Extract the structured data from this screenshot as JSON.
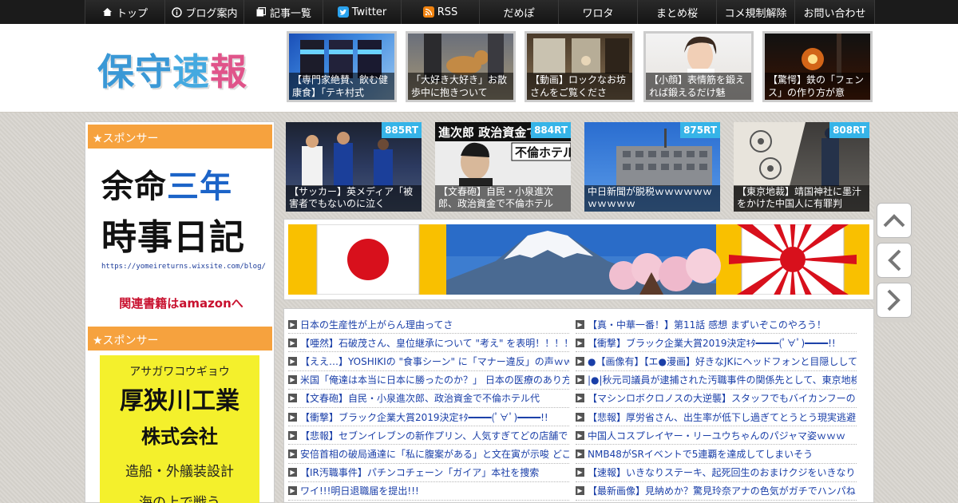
{
  "nav": {
    "items": [
      {
        "label": "トップ",
        "icon": "home-icon"
      },
      {
        "label": "ブログ案内",
        "icon": "info-icon"
      },
      {
        "label": "記事一覧",
        "icon": "list-icon"
      },
      {
        "label": "Twitter",
        "icon": "twitter-icon"
      },
      {
        "label": "RSS",
        "icon": "rss-icon"
      },
      {
        "label": "だめぽ",
        "icon": ""
      },
      {
        "label": "ワロタ",
        "icon": ""
      },
      {
        "label": "まとめ桜",
        "icon": ""
      },
      {
        "label": "コメ規制解除",
        "icon": ""
      },
      {
        "label": "お問い合わせ",
        "icon": ""
      }
    ]
  },
  "header": {
    "logo": [
      "保",
      "守",
      "速",
      "報"
    ],
    "thumbs": [
      {
        "caption": "【専門家絶賛、飲む健康食】「テキ村式"
      },
      {
        "caption": "「大好き大好き」お散歩中に抱きついて"
      },
      {
        "caption": "【動画】ロックなお坊さんをご覧くださ"
      },
      {
        "caption": "【小顔】表情筋を鍛えれば鍛えるだけ魅"
      },
      {
        "caption": "【驚愕】鉄の「フェンス」の作り方が意"
      }
    ]
  },
  "sidebar": {
    "sponsor1": "★スポンサー",
    "ad1": {
      "line1a": "余命",
      "line1b": "三年",
      "line2": "時事日記",
      "url": "https://yomeireturns.wixsite.com/blog/",
      "amazon": "関連書籍はamazonへ"
    },
    "sponsor2": "★スポンサー",
    "ad2": {
      "kana": "アサガワコウギョウ",
      "name": "厚狭川工業",
      "corp": "株式会社",
      "service": "造船・外艤装設計",
      "more": "海の上で戦う"
    }
  },
  "main": {
    "rt_items": [
      {
        "badge": "885RT",
        "caption": "【サッカー】英メディア「被害者でもないのに泣く"
      },
      {
        "badge": "884RT",
        "caption": "【文春砲】自民・小泉進次郎、政治資金で不倫ホテル"
      },
      {
        "badge": "875RT",
        "caption": "中日新聞が脱税ｗｗｗｗｗｗｗｗｗｗｗ"
      },
      {
        "badge": "808RT",
        "caption": "【東京地裁】靖国神社に墨汁をかけた中国人に有罪判"
      }
    ],
    "list_left": [
      "日本の生産性が上がらん理由ってさ",
      "【唖然】石破茂さん、皇位継承について \"考え\" を表明！！！！",
      "【ええ…】YOSHIKIの \"食事シーン\" に「マナー違反」の声ｗｗｗ",
      "米国「俺達は本当に日本に勝ったのか？」 日本の医療のあり方",
      "【文春砲】自民・小泉進次郎、政治資金で不倫ホテル代",
      "【衝撃】ブラック企業大賞2019決定ｷﾀ━━━━(ﾟ∀ﾟ)━━━━!!",
      "【悲報】セブンイレブンの新作プリン、人気すぎてどの店舗で",
      "安倍首相の破局通達に「私に腹案がある」と文在寅が示唆 どこ",
      "【IR汚職事件】パチンコチェーン「ガイア」本社を捜索",
      "ワイ!!!明日退職届を提出!!!"
    ],
    "list_right": [
      "【真・中華一番！】第11話 感想 まずいぞこのやろう！",
      "【衝撃】ブラック企業大賞2019決定ｷﾀ━━━━(ﾟ∀ﾟ)━━━━!!",
      "●【画像有】【エ●漫画】好きなJKにヘッドフォンと目隠しして",
      "|●|秋元司議員が逮捕された汚職事件の関係先として、東京地検",
      "【マシンロボクロノスの大逆襲】スタッフでもバイカンフーの",
      "【悲報】厚労省さん、出生率が低下し過ぎてとうとう現実逃避",
      "中国人コスプレイヤー・リーユウちゃんのパジャマ姿ｗｗｗ",
      "NMB48がSRイベントで5連覇を達成してしまいそう",
      "【速報】いきなりステーキ、起死回生のおまけクジをいきなり",
      "【最新画像】見納めか？驚見玲奈アナの色気がガチでハンパね"
    ]
  },
  "colors": {
    "nav_bg": "#1b1b1b",
    "sponsor_orange": "#f6a23e",
    "rt_blue": "#36b4e8",
    "link_blue": "#1a3fa8",
    "banner_yellow": "#f9c000"
  }
}
